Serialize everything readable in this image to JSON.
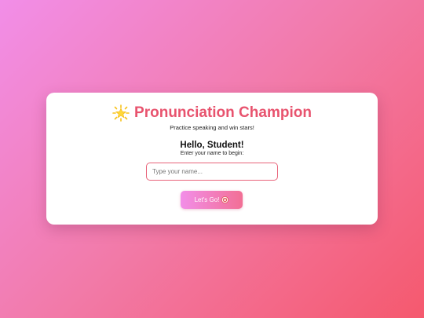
{
  "header": {
    "title": "Pronunciation Champion",
    "title_icon": "glowing-star-icon",
    "subtitle": "Practice speaking and win stars!"
  },
  "welcome": {
    "greeting": "Hello, Student!",
    "prompt": "Enter your name to begin:"
  },
  "name_input": {
    "value": "",
    "placeholder": "Type your name..."
  },
  "start_button": {
    "label": "Let's Go!",
    "icon": "target-icon"
  },
  "colors": {
    "accent": "#e8536e",
    "background_start": "#f28ee8",
    "background_end": "#f5596e"
  }
}
